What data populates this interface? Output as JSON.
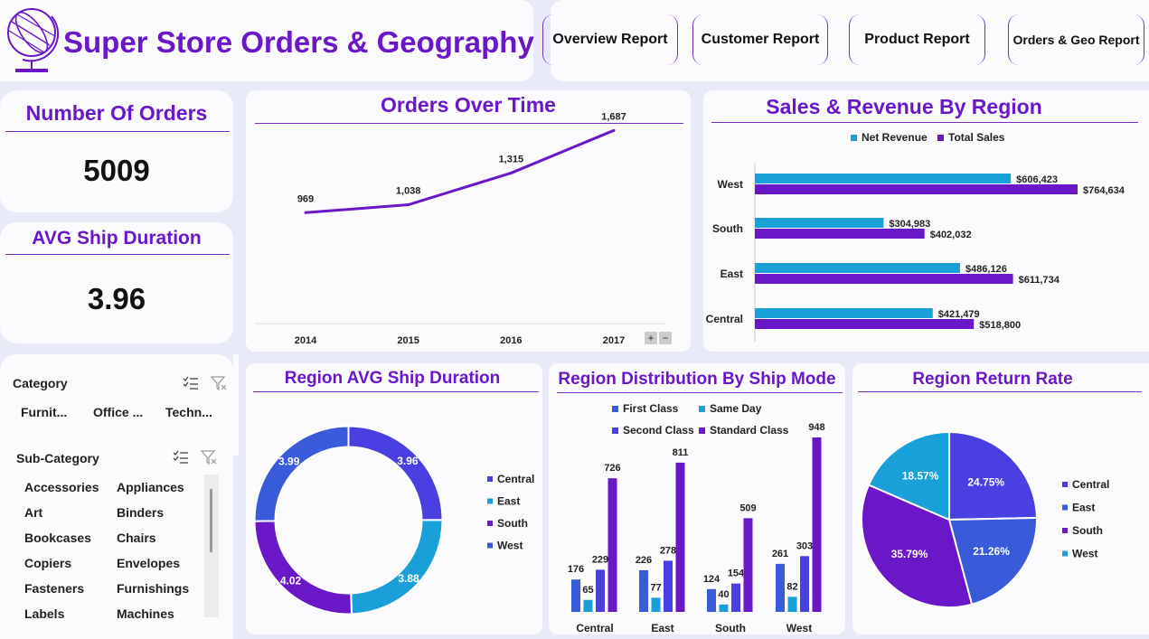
{
  "header": {
    "title": "Super Store Orders & Geography",
    "logo_icon": "globe-icon"
  },
  "nav": {
    "items": [
      {
        "label": "Overview Report"
      },
      {
        "label": "Customer Report"
      },
      {
        "label": "Product Report"
      },
      {
        "label": "Orders & Geo Report"
      }
    ]
  },
  "kpis": {
    "orders": {
      "title": "Number Of Orders",
      "value": "5009"
    },
    "ship": {
      "title": "AVG Ship Duration",
      "value": "3.96"
    }
  },
  "slicers": {
    "category": {
      "title": "Category",
      "items": [
        "Furnit...",
        "Office ...",
        "Techn..."
      ]
    },
    "subcategory": {
      "title": "Sub-Category",
      "items": [
        "Accessories",
        "Appliances",
        "Art",
        "Binders",
        "Bookcases",
        "Chairs",
        "Copiers",
        "Envelopes",
        "Fasteners",
        "Furnishings",
        "Labels",
        "Machines"
      ]
    },
    "icons": [
      "multi-select-icon",
      "clear-filter-icon"
    ]
  },
  "colors": {
    "accent": "#6a17c8",
    "blue": "#3a5bd9",
    "cyan": "#1aa0d8",
    "purple": "#6a17c8",
    "indigo": "#4a3fe0"
  },
  "chart_data": [
    {
      "type": "line",
      "title": "Orders Over Time",
      "x": [
        "2014",
        "2015",
        "2016",
        "2017"
      ],
      "values": [
        969,
        1038,
        1315,
        1687
      ],
      "labels": [
        "969",
        "1,038",
        "1,315",
        "1,687"
      ],
      "ylim": [
        0,
        1800
      ],
      "zoom_controls": [
        "+",
        "−"
      ]
    },
    {
      "type": "bar",
      "title": "Sales & Revenue By Region",
      "orientation": "horizontal",
      "categories": [
        "West",
        "South",
        "East",
        "Central"
      ],
      "series": [
        {
          "name": "Net Revenue",
          "values": [
            606423,
            304983,
            486126,
            421479
          ],
          "labels": [
            "$606,423",
            "$304,983",
            "$486,126",
            "$421,479"
          ]
        },
        {
          "name": "Total Sales",
          "values": [
            764634,
            402032,
            611734,
            518800
          ],
          "labels": [
            "$764,634",
            "$402,032",
            "$611,734",
            "$518,800"
          ]
        }
      ],
      "xlim": [
        0,
        800000
      ],
      "legend": "top"
    },
    {
      "type": "pie",
      "title": "Region AVG Ship Duration",
      "style": "donut",
      "categories": [
        "Central",
        "East",
        "South",
        "West"
      ],
      "values": [
        3.96,
        3.88,
        4.02,
        3.99
      ],
      "labels": [
        "3.96",
        "3.88",
        "4.02",
        "3.99"
      ],
      "legend": "right"
    },
    {
      "type": "bar",
      "title": "Region Distribution By Ship Mode",
      "categories": [
        "Central",
        "East",
        "South",
        "West"
      ],
      "series": [
        {
          "name": "First Class",
          "values": [
            176,
            226,
            124,
            261
          ]
        },
        {
          "name": "Same Day",
          "values": [
            65,
            77,
            40,
            82
          ]
        },
        {
          "name": "Second Class",
          "values": [
            229,
            278,
            154,
            303
          ]
        },
        {
          "name": "Standard Class",
          "values": [
            726,
            811,
            509,
            948
          ]
        }
      ],
      "ylim": [
        0,
        1000
      ],
      "legend": "top"
    },
    {
      "type": "pie",
      "title": "Region Return Rate",
      "categories": [
        "Central",
        "East",
        "South",
        "West"
      ],
      "values": [
        24.75,
        21.26,
        35.79,
        18.57
      ],
      "labels": [
        "24.75%",
        "21.26%",
        "35.79%",
        "18.57%"
      ],
      "legend": "right"
    }
  ]
}
